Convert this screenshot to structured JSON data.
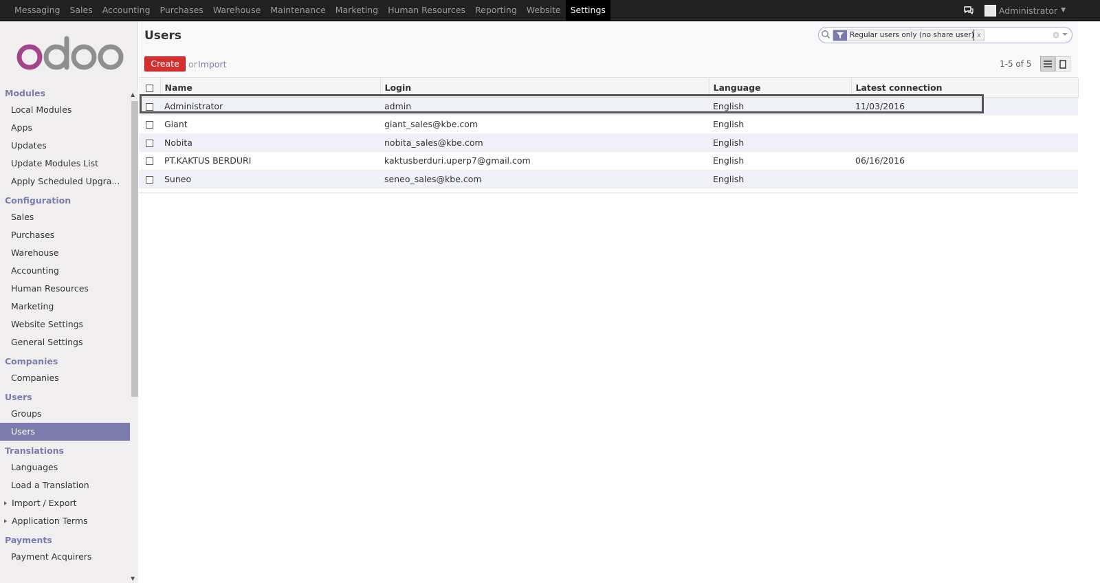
{
  "topbar": {
    "menu": [
      "Messaging",
      "Sales",
      "Accounting",
      "Purchases",
      "Warehouse",
      "Maintenance",
      "Marketing",
      "Human Resources",
      "Reporting",
      "Website",
      "Settings"
    ],
    "active": "Settings",
    "user": "Administrator"
  },
  "sidebar": {
    "sections": [
      {
        "title": "Modules",
        "items": [
          "Local Modules",
          "Apps",
          "Updates",
          "Update Modules List",
          "Apply Scheduled Upgra..."
        ]
      },
      {
        "title": "Configuration",
        "items": [
          "Sales",
          "Purchases",
          "Warehouse",
          "Accounting",
          "Human Resources",
          "Marketing",
          "Website Settings",
          "General Settings"
        ]
      },
      {
        "title": "Companies",
        "items": [
          "Companies"
        ]
      },
      {
        "title": "Users",
        "items": [
          "Groups",
          "Users"
        ]
      },
      {
        "title": "Translations",
        "items": [
          "Languages",
          "Load a Translation",
          "Import / Export",
          "Application Terms"
        ]
      },
      {
        "title": "Payments",
        "items": [
          "Payment Acquirers"
        ]
      }
    ],
    "active_item": "Users"
  },
  "main": {
    "title": "Users",
    "create_label": "Create",
    "or_label": "or",
    "import_label": "Import",
    "pager": "1-5 of 5",
    "search": {
      "facet": "Regular users only (no share user)",
      "facet_remove": "x",
      "value": ""
    },
    "table": {
      "columns": [
        "Name",
        "Login",
        "Language",
        "Latest connection"
      ],
      "rows": [
        {
          "name": "Administrator",
          "login": "admin",
          "language": "English",
          "latest": "11/03/2016"
        },
        {
          "name": "Giant",
          "login": "giant_sales@kbe.com",
          "language": "English",
          "latest": ""
        },
        {
          "name": "Nobita",
          "login": "nobita_sales@kbe.com",
          "language": "English",
          "latest": ""
        },
        {
          "name": "PT.KAKTUS BERDURI",
          "login": "kaktusberduri.uperp7@gmail.com",
          "language": "English",
          "latest": "06/16/2016"
        },
        {
          "name": "Suneo",
          "login": "seneo_sales@kbe.com",
          "language": "English",
          "latest": ""
        }
      ]
    }
  },
  "colors": {
    "accent": "#7c7bad",
    "create": "#d42e2e",
    "navbar": "#212121",
    "row_alt": "#eff0f8"
  }
}
